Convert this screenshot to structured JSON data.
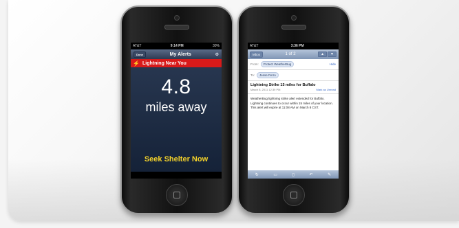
{
  "phone1": {
    "status": {
      "carrier": "AT&T",
      "time": "9:14 PM",
      "battery": "30%"
    },
    "navbar": {
      "left_button": "Done",
      "title": "My Alerts",
      "right_icon": "gear-icon"
    },
    "alert_banner": {
      "icon": "lightning-icon",
      "text": "Lightning Near You"
    },
    "distance_value": "4.8",
    "distance_unit": "miles away",
    "action_text": "Seek Shelter Now"
  },
  "phone2": {
    "status": {
      "carrier": "AT&T",
      "time": "3:36 PM",
      "battery": ""
    },
    "navbar": {
      "back_label": "Mbox",
      "count": "1 of 2",
      "prev_icon": "up-arrow-icon",
      "next_icon": "down-arrow-icon"
    },
    "from_label": "From:",
    "from_value": "Protect WeatherBug",
    "hide_label": "Hide",
    "to_label": "To:",
    "to_value": "Jesse Ferro",
    "subject": "Lightning Strike 15 miles for Buffalo",
    "date": "March 8, 2011 12:39 PM",
    "mark_unread": "Mark as Unread",
    "body": "WeatherBug lightning strike alert extended for Buffalo. Lightning continues to occur within 15 miles of your location. This alert will expire at 11:08 AM on March 8 CST.",
    "toolbar_icons": [
      "refresh-icon",
      "folder-icon",
      "trash-icon",
      "reply-icon",
      "compose-icon"
    ]
  }
}
